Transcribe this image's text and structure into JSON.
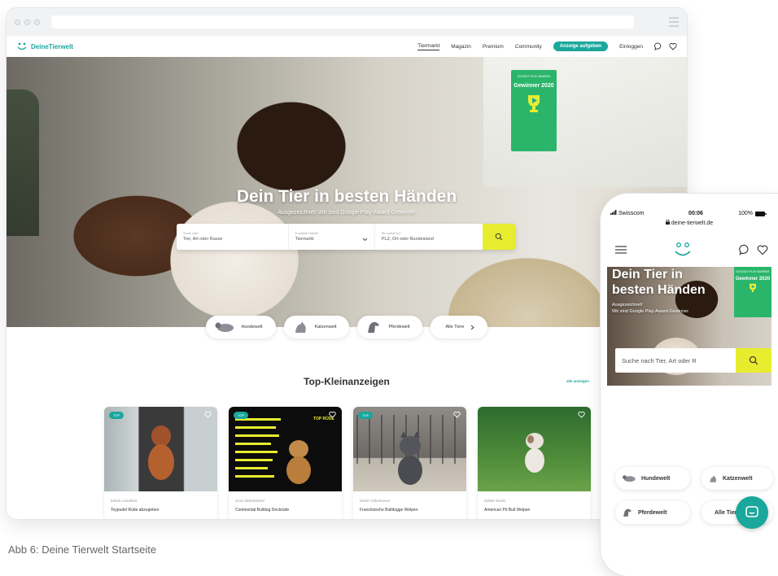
{
  "desktop": {
    "logo": "DeineTierwelt",
    "nav": {
      "tiermarkt": "Tiermarkt",
      "magazin": "Magazin",
      "premium": "Premium",
      "community": "Community",
      "cta": "Anzeige aufgeben",
      "login": "Einloggen"
    },
    "hero": {
      "title": "Dein Tier in besten Händen",
      "subtitle": "Ausgezeichnet! Wir sind Google Play-Award-Gewinner",
      "award_small": "GOOGLE PLAY AWARDS",
      "award_big": "Gewinner 2020"
    },
    "search": {
      "field1_label": "Suche nach",
      "field1_value": "Tier, Art oder Rasse",
      "field2_label": "In welcher Rubrik?",
      "field2_value": "Tiermarkt",
      "field3_label": "Wo suchst Du?",
      "field3_value": "PLZ, Ort oder Bundesland"
    },
    "chips": [
      "Hundewelt",
      "Katzenwelt",
      "Pferdewelt",
      "Alle Tiere"
    ],
    "section_title": "Top-Kleinanzeigen",
    "all_link": "alle anzeigen",
    "cards": [
      {
        "badge": "TOP",
        "location": "84032 Landshut",
        "title": "Toypudel Rüde abzugeben"
      },
      {
        "badge": "TOP",
        "location": "4316 ZEININGEN",
        "title": "Continental Bulldog Deckrüde"
      },
      {
        "badge": "TOP",
        "location": "50457 Aldenhoven",
        "title": "Französische Bulldogge Welpen"
      },
      {
        "badge": "",
        "location": "23992 Glasin",
        "title": "American Pit Bull Welpen"
      }
    ],
    "card2_sign": "TOP RÜDE"
  },
  "caption": "Abb 6: Deine Tierwelt Startseite",
  "phone": {
    "carrier": "Swisscom",
    "time": "00:06",
    "battery": "100%",
    "url": "deine-tierwelt.de",
    "hero_title_line1": "Dein Tier in",
    "hero_title_line2": "besten Händen",
    "hero_sub_line1": "Ausgezeichnet!",
    "hero_sub_line2": "Wir sind Google Play-Award-Gewinner",
    "award_small": "GOOGLE PLAY AWARDS",
    "award_big": "Gewinner 2020",
    "search_placeholder": "Suche nach Tier, Art oder R",
    "chips": [
      "Hundewelt",
      "Katzenwelt",
      "Pferdewelt",
      "Alle Tiere"
    ]
  },
  "colors": {
    "brand": "#1aa79c",
    "search_button": "#e8ec2f",
    "award": "#2bb56b"
  }
}
